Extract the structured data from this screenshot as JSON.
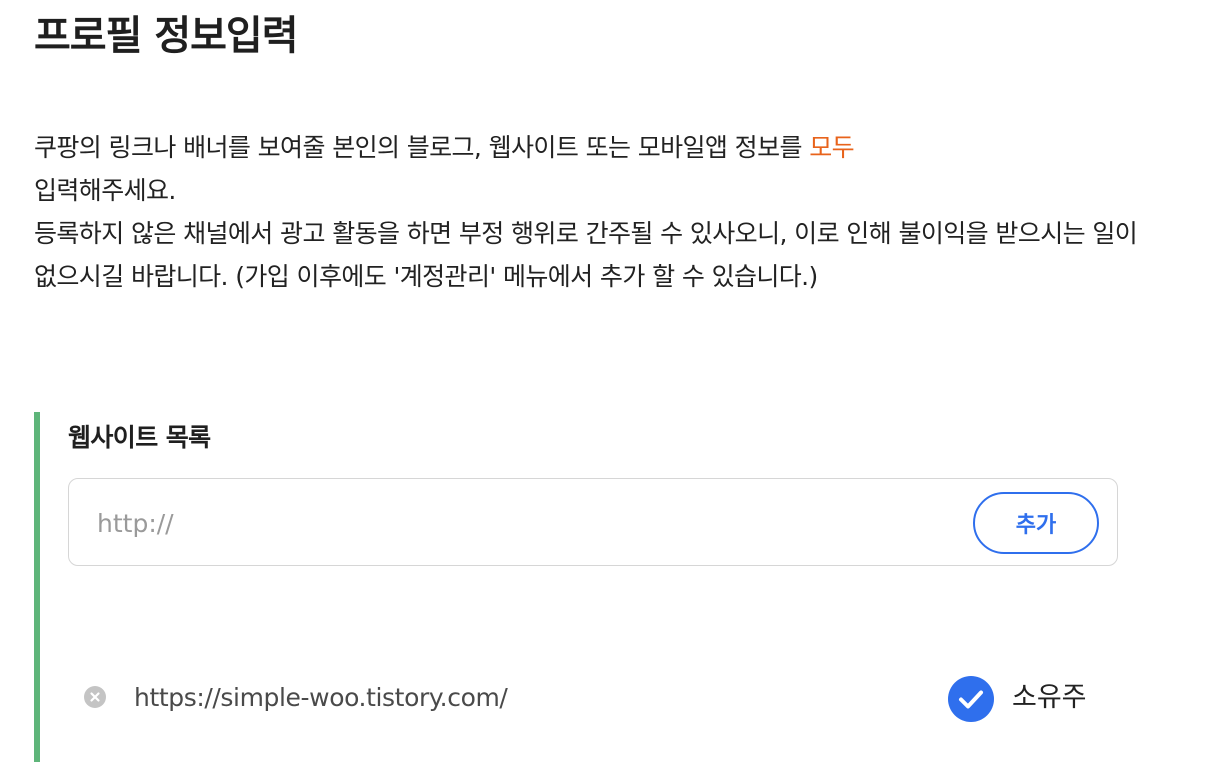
{
  "page_title": "프로필 정보입력",
  "description": {
    "line1_main": "쿠팡의 링크나 배너를 보여줄 본인의 블로그, 웹사이트 또는 모바일앱 정보를 ",
    "line1_highlight": "모두",
    "line2": "입력해주세요.",
    "paragraph2": "등록하지 않은 채널에서 광고 활동을 하면 부정 행위로 간주될 수 있사오니, 이로 인해 불이익을 받으시는 일이 없으시길 바랍니다. (가입 이후에도 '계정관리' 메뉴에서 추가 할 수 있습니다.)",
    "highlight_color": "#e8631b"
  },
  "website_section": {
    "title": "웹사이트 목록",
    "input": {
      "placeholder": "http://",
      "value": ""
    },
    "add_button_label": "추가",
    "items": [
      {
        "url": "https://simple-woo.tistory.com/",
        "owner_label": "소유주",
        "owner_checked": true,
        "remove_icon": "close-circle-icon",
        "check_icon": "check-circle-icon"
      }
    ]
  },
  "colors": {
    "accent_blue": "#2f6fed",
    "section_bar_green": "#5eb57a"
  }
}
